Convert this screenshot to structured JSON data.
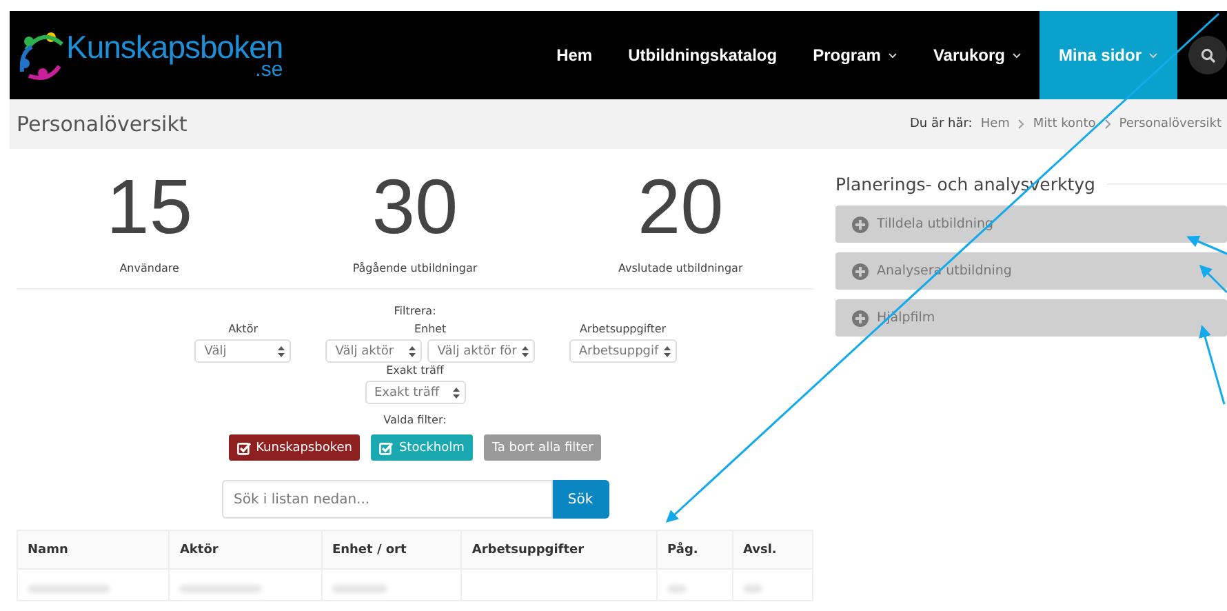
{
  "logo": {
    "name": "Kunskapsboken",
    "suffix": ".se"
  },
  "nav": [
    {
      "label": "Hem",
      "dropdown": false,
      "selected": false
    },
    {
      "label": "Utbildningskatalog",
      "dropdown": false,
      "selected": false
    },
    {
      "label": "Program",
      "dropdown": true,
      "selected": false
    },
    {
      "label": "Varukorg",
      "dropdown": true,
      "selected": false
    },
    {
      "label": "Mina sidor",
      "dropdown": true,
      "selected": true
    }
  ],
  "page_title": "Personalöversikt",
  "breadcrumb": {
    "label": "Du är här:",
    "items": [
      "Hem",
      "Mitt konto",
      "Personalöversikt"
    ]
  },
  "stats": [
    {
      "value": "15",
      "label": "Användare"
    },
    {
      "value": "30",
      "label": "Pågående utbildningar"
    },
    {
      "value": "20",
      "label": "Avslutade utbildningar"
    }
  ],
  "filter": {
    "title": "Filtrera:",
    "groups": [
      {
        "label": "Aktör",
        "selects": [
          "Välj"
        ]
      },
      {
        "label": "Enhet",
        "selects": [
          "Välj aktör",
          "Välj aktör för"
        ]
      },
      {
        "label": "Arbetsuppgifter",
        "selects": [
          "Arbetsuppgif"
        ]
      }
    ],
    "exact": {
      "label": "Exakt träff",
      "select": "Exakt träff"
    },
    "chosen_label": "Valda filter:",
    "chips": [
      {
        "kind": "filter",
        "label": "Kunskapsboken",
        "color": "#8e2020"
      },
      {
        "kind": "filter",
        "label": "Stockholm",
        "color": "#1aa9b0"
      },
      {
        "kind": "clear",
        "label": "Ta bort alla filter",
        "color": "#9a9a9a"
      }
    ]
  },
  "search": {
    "placeholder": "Sök i listan nedan...",
    "button": "Sök"
  },
  "table": {
    "columns": [
      "Namn",
      "Aktör",
      "Enhet / ort",
      "Arbetsuppgifter",
      "Påg.",
      "Avsl."
    ]
  },
  "tools": {
    "title": "Planerings- och analysverktyg",
    "items": [
      {
        "label": "Tilldela utbildning",
        "expanded": false
      },
      {
        "label": "Analysera utbildning",
        "expanded": false
      },
      {
        "label": "Hjälpfilm",
        "expanded": false
      }
    ]
  }
}
